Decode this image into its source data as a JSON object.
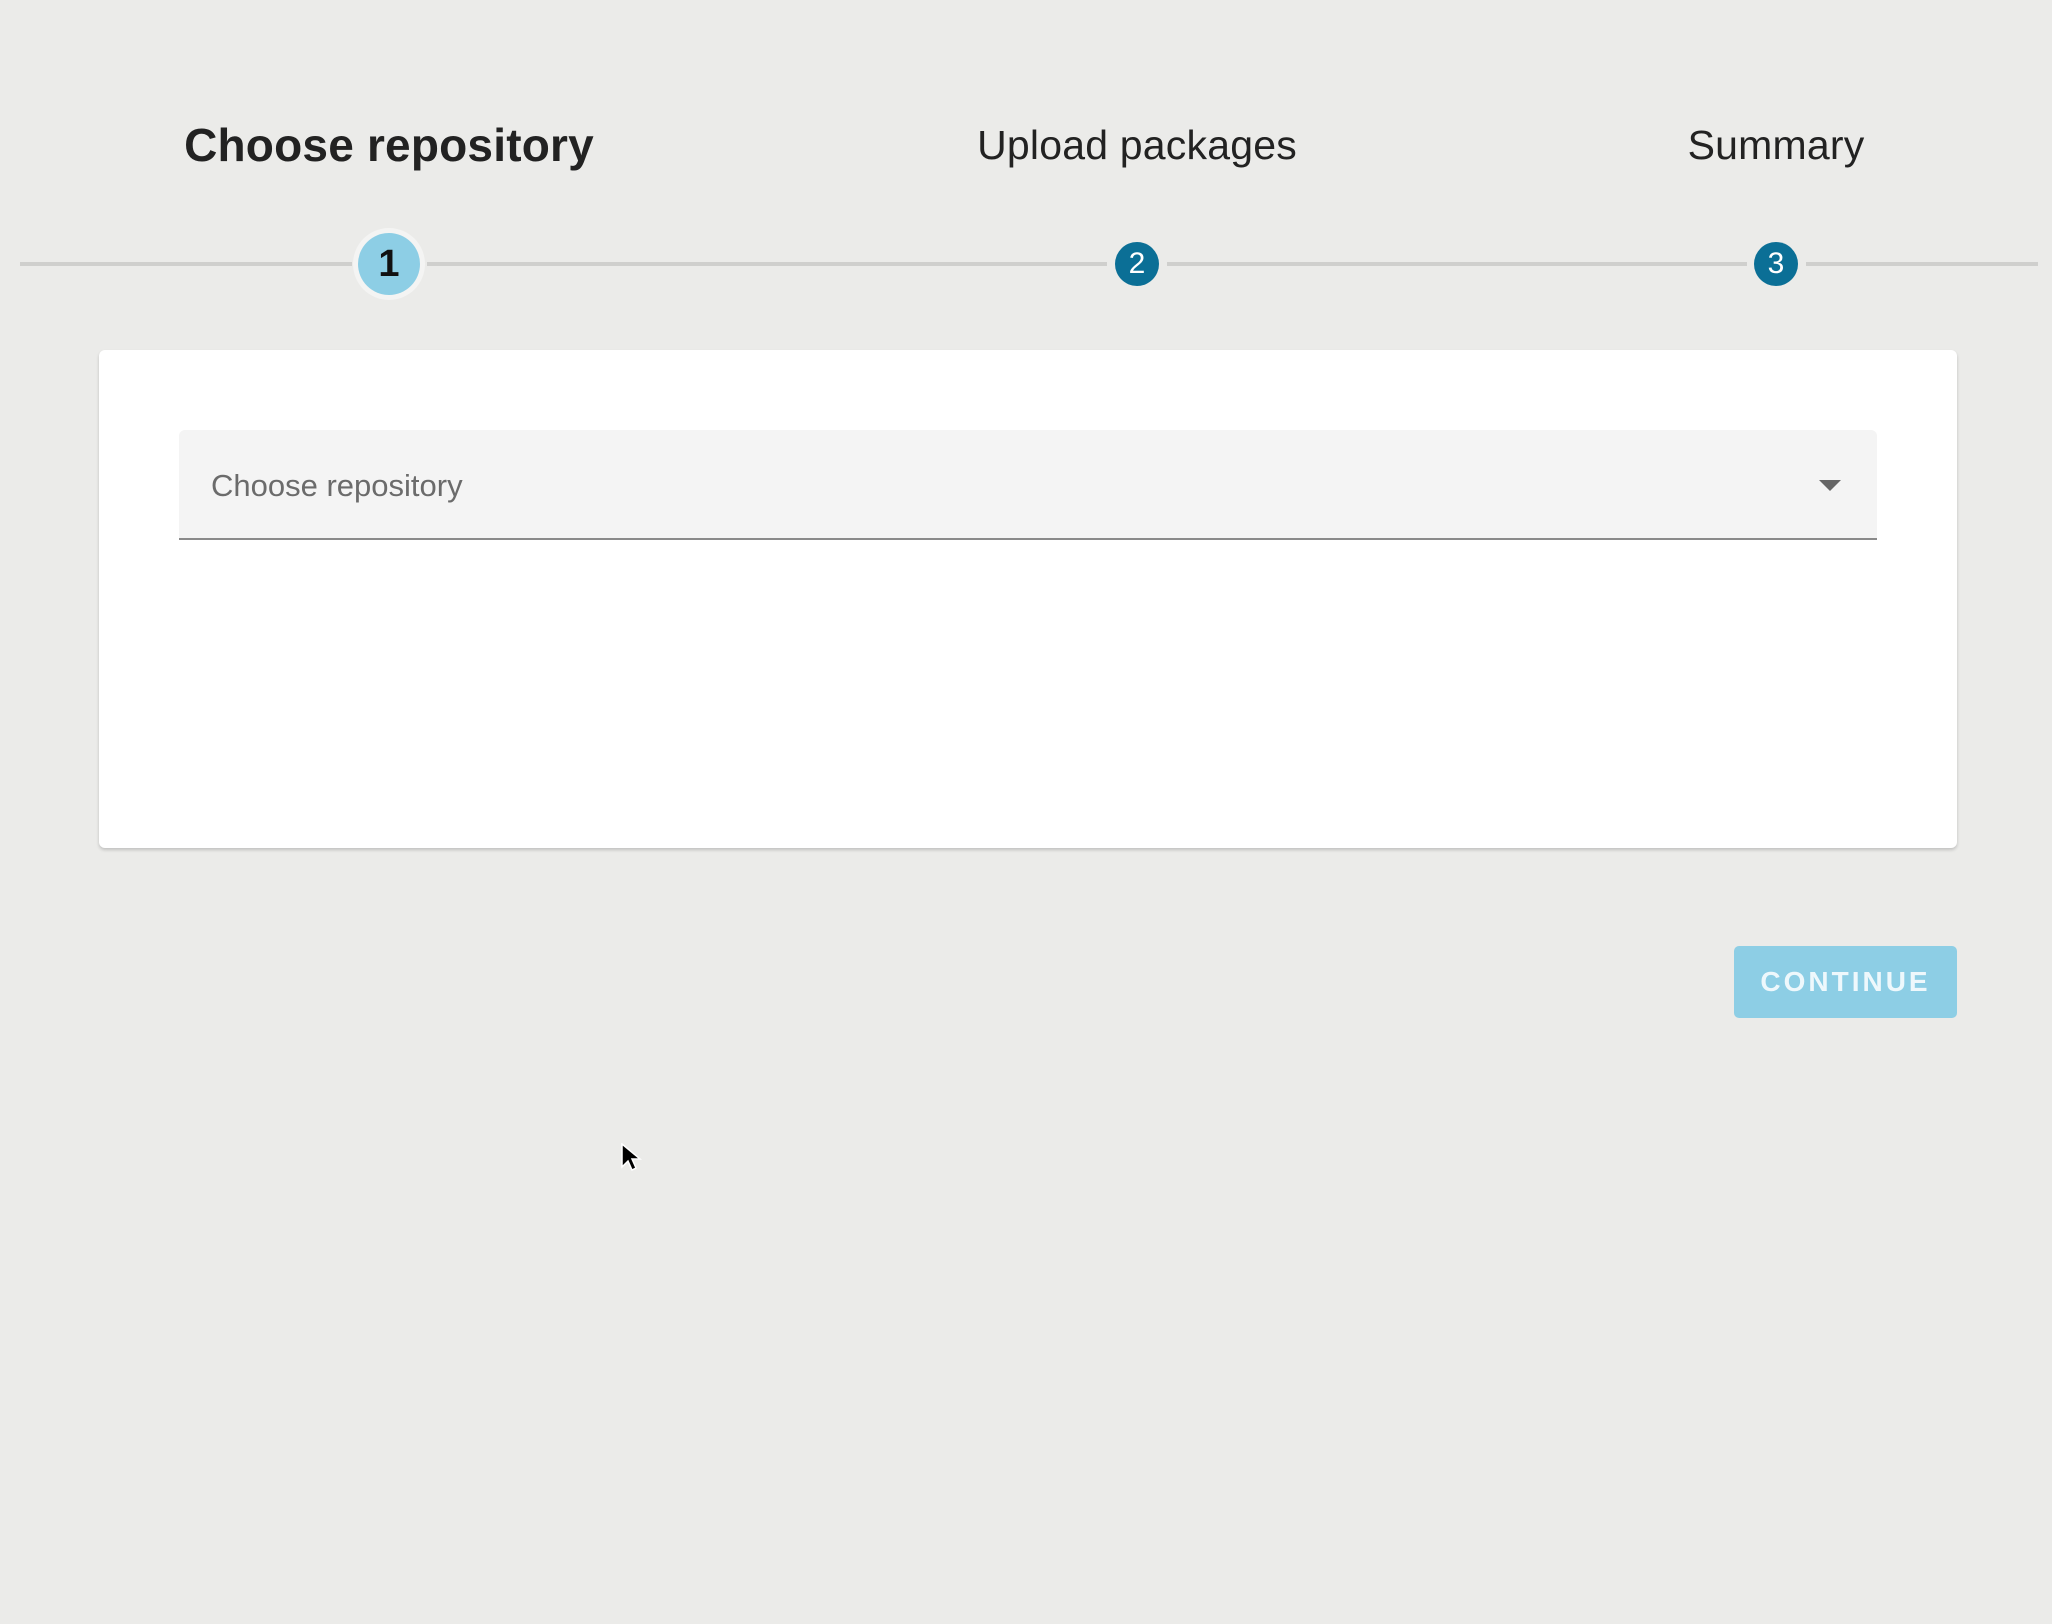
{
  "stepper": {
    "steps": [
      {
        "title": "Choose repository",
        "number": "1",
        "state": "active"
      },
      {
        "title": "Upload packages",
        "number": "2",
        "state": "inactive"
      },
      {
        "title": "Summary",
        "number": "3",
        "state": "inactive"
      }
    ]
  },
  "form": {
    "repository_select": {
      "label": "Choose repository",
      "value": ""
    }
  },
  "actions": {
    "continue_label": "CONTINUE",
    "continue_enabled": false
  },
  "colors": {
    "background": "#ebebe9",
    "active_step": "#8dcee5",
    "inactive_step": "#0b6f96",
    "button_disabled": "#8dcee5"
  },
  "icons": {
    "dropdown": "chevron-down-icon",
    "cursor": "mouse-pointer-icon"
  }
}
